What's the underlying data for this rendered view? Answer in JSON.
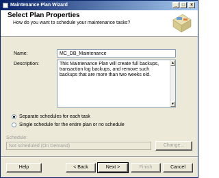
{
  "window": {
    "title": "Maintenance Plan Wizard",
    "minimize_glyph": "_",
    "maximize_glyph": "□",
    "close_glyph": "×"
  },
  "header": {
    "title": "Select Plan Properties",
    "subtitle": "How do you want to schedule your maintenance tasks?"
  },
  "form": {
    "name_label": "Name:",
    "name_value": "MC_DB_Maintenance",
    "description_label": "Description:",
    "description_value": "This Maintenance Plan will create full backups, transaction log backups, and remove such backups that are more than two weeks old."
  },
  "schedule_options": [
    {
      "label": "Separate schedules for each task",
      "selected": true
    },
    {
      "label": "Single schedule for the entire plan or no schedule",
      "selected": false
    }
  ],
  "schedule": {
    "label": "Schedule:",
    "value": "Not scheduled (On Demand)",
    "change_button": "Change..."
  },
  "buttons": {
    "help": "Help",
    "back": "< Back",
    "next": "Next >",
    "finish": "Finish",
    "cancel": "Cancel"
  },
  "icons": {
    "wizard": "wizard-graphic-icon",
    "window": "app-window-icon"
  }
}
